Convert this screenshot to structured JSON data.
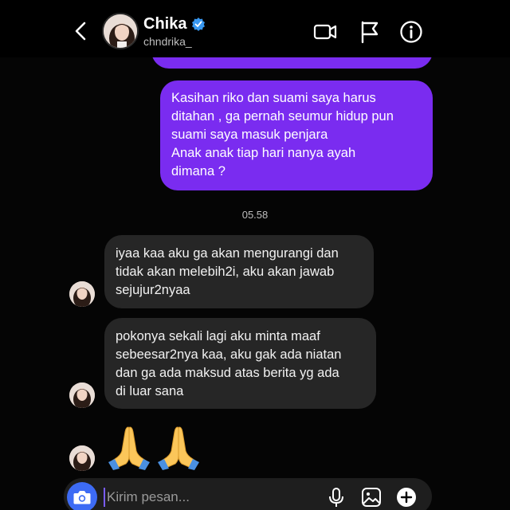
{
  "header": {
    "title": "Chika",
    "username": "chndrika_",
    "icons": [
      "back-icon",
      "verified-badge-icon",
      "video-call-icon",
      "flag-icon",
      "info-icon"
    ]
  },
  "messages": {
    "outgoing_main": [
      "Kasihan riko dan suami saya harus",
      "ditahan , ga pernah seumur hidup pun",
      "suami saya masuk penjara",
      "Anak anak tiap hari nanya ayah",
      "dimana ?"
    ],
    "timestamp": "05.58",
    "incoming_1": [
      "iyaa kaa aku ga akan mengurangi dan",
      "tidak akan melebih2i, aku akan jawab",
      "sejujur2nyaa"
    ],
    "incoming_2": [
      "pokonya sekali lagi aku minta maaf",
      "sebeesar2nya kaa, aku gak ada niatan",
      "dan ga ada maksud atas berita yg ada",
      "di luar sana"
    ],
    "incoming_3_emoji": "🙏🙏"
  },
  "composer": {
    "placeholder": "Kirim pesan...",
    "icons": [
      "camera-icon",
      "microphone-icon",
      "gallery-icon",
      "plus-icon"
    ]
  },
  "colors": {
    "outgoing_bubble": "#7a2cf0",
    "incoming_bubble": "#262626",
    "background": "#000000",
    "camera_button": "#3d6bf4",
    "verified": "#3897f0"
  }
}
